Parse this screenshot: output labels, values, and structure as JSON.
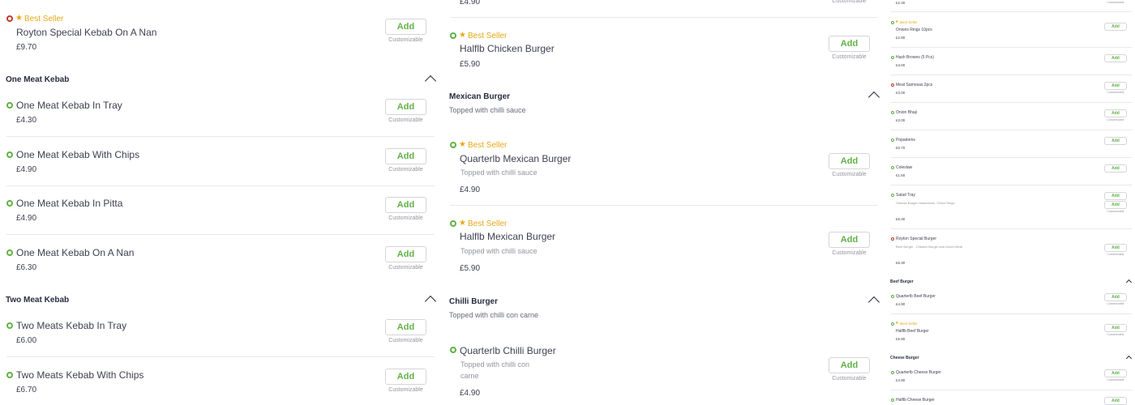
{
  "common": {
    "add": "Add",
    "customizable": "Customizable",
    "best_seller": "Best Seller"
  },
  "col1": {
    "top_item": {
      "name": "Royton Special Kebab On A Nan",
      "price": "£9.70",
      "best_seller": true,
      "type": "nonveg"
    },
    "sections": [
      {
        "title": "One Meat Kebab",
        "items": [
          {
            "name": "One Meat Kebab In Tray",
            "price": "£4.30"
          },
          {
            "name": "One Meat Kebab With Chips",
            "price": "£4.90"
          },
          {
            "name": "One Meat Kebab In Pitta",
            "price": "£4.90"
          },
          {
            "name": "One Meat Kebab On A Nan",
            "price": "£6.30"
          }
        ]
      },
      {
        "title": "Two Meat Kebab",
        "items": [
          {
            "name": "Two Meats Kebab In Tray",
            "price": "£6.00"
          },
          {
            "name": "Two Meats Kebab With Chips",
            "price": "£6.70"
          }
        ]
      }
    ]
  },
  "col2": {
    "top_price": "£4.90",
    "halflb_chicken": {
      "name": "Halflb Chicken Burger",
      "price": "£5.90"
    },
    "mexican": {
      "title": "Mexican Burger",
      "subtitle": "Topped with chilli sauce",
      "items": [
        {
          "name": "Quarterlb Mexican Burger",
          "desc": "Topped with chilli sauce",
          "price": "£4.90"
        },
        {
          "name": "Halflb Mexican Burger",
          "desc": "Topped with chilli sauce",
          "price": "£5.90"
        }
      ]
    },
    "chilli": {
      "title": "Chilli Burger",
      "subtitle": "Topped with chilli con carne",
      "items": [
        {
          "name": "Quarterlb Chilli Burger",
          "desc_line1": "Topped with chilli con",
          "desc_line2": "carne",
          "price": "£4.90"
        }
      ]
    }
  },
  "col3": {
    "top_price": "£2.30",
    "items": [
      {
        "name": "Onions Rings 10pcs",
        "price": "£2.80"
      },
      {
        "name": "Hash Browns (5 Pcs)",
        "price": "£3.00"
      },
      {
        "name": "Meat Samosas 2pcs",
        "price": "£3.00"
      },
      {
        "name": "Onion Bhaji",
        "price": "£3.00"
      },
      {
        "name": "Popadoms",
        "price": "£0.70"
      },
      {
        "name": "Coleslaw",
        "price": "£1.50"
      },
      {
        "name": "Salad Tray",
        "desc": "Cheese Burger Hashbrown, Onion Rings",
        "price": "£6.30"
      },
      {
        "name": "Royton Special Burger",
        "desc": "Beef Burger , Chicken Burger and Doner Meat",
        "price": "£6.30"
      }
    ],
    "beef": {
      "title": "Beef Burger",
      "items": [
        {
          "name": "Quarterlb Beef Burger",
          "price": "£4.90"
        },
        {
          "name": "Halflb Beef Burger",
          "price": "£5.90"
        }
      ]
    },
    "cheese": {
      "title": "Cheese Burger",
      "items": [
        {
          "name": "Quarterlb Cheese Burger",
          "price": "£4.90"
        },
        {
          "name": "Halflb Cheese Burger"
        }
      ]
    }
  }
}
